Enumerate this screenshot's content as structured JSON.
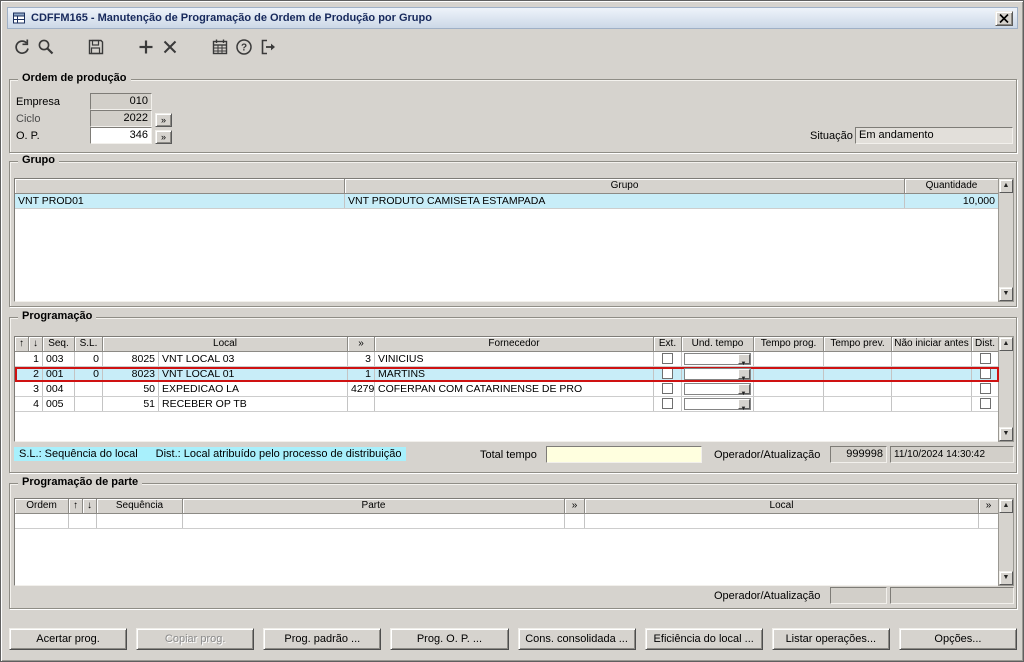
{
  "window": {
    "title": "CDFFM165 - Manutenção de Programação de Ordem de Produção por Grupo"
  },
  "colors": {
    "row_highlight": "#c8edf8",
    "selection_border": "#cf1212",
    "note_bg": "#a8f0fc",
    "total_field_bg": "#ffffdf",
    "title_text": "#17295c"
  },
  "toolbar": {
    "icons": [
      "undo",
      "search",
      "save",
      "add",
      "delete",
      "schedule",
      "help",
      "exit"
    ]
  },
  "ui": {
    "zoom": "»",
    "up": "↑",
    "down": "↓"
  },
  "ordem": {
    "legend": "Ordem de produção",
    "empresa_label": "Empresa",
    "empresa_value": "010",
    "ciclo_label": "Ciclo",
    "ciclo_value": "2022",
    "op_label": "O. P.",
    "op_value": "346",
    "situacao_label": "Situação",
    "situacao_value": "Em andamento"
  },
  "grupo": {
    "legend": "Grupo",
    "headers": {
      "grupo": "Grupo",
      "quantidade": "Quantidade"
    },
    "row": {
      "codigo": "VNT PROD01",
      "descricao": "VNT PRODUTO CAMISETA ESTAMPADA",
      "quantidade": "10,000"
    }
  },
  "prog": {
    "legend": "Programação",
    "headers": {
      "seq": "Seq.",
      "sl": "S.L.",
      "local": "Local",
      "fornecedor": "Fornecedor",
      "ext": "Ext.",
      "und_tempo": "Und. tempo",
      "tempo_prog": "Tempo prog.",
      "tempo_prev": "Tempo prev.",
      "nao_iniciar": "Não iniciar antes",
      "dist": "Dist."
    },
    "rows": [
      {
        "num": "1",
        "seq": "003",
        "sl": "0",
        "local_cod": "8025",
        "local": "VNT LOCAL 03",
        "forn_cod": "3",
        "fornecedor": "VINICIUS"
      },
      {
        "num": "2",
        "seq": "001",
        "sl": "0",
        "local_cod": "8023",
        "local": "VNT LOCAL 01",
        "forn_cod": "1",
        "fornecedor": "MARTINS"
      },
      {
        "num": "3",
        "seq": "004",
        "sl": "",
        "local_cod": "50",
        "local": "EXPEDICAO LA",
        "forn_cod": "4279",
        "fornecedor": "COFERPAN COM CATARINENSE DE PRO"
      },
      {
        "num": "4",
        "seq": "005",
        "sl": "",
        "local_cod": "51",
        "local": "RECEBER OP TB",
        "forn_cod": "",
        "fornecedor": ""
      }
    ],
    "note_sl": "S.L.: Sequência do local",
    "note_dist": "Dist.: Local atribuído pelo processo de distribuição",
    "total_tempo_label": "Total tempo",
    "operador_label": "Operador/Atualização",
    "operador_value": "999998",
    "atualizacao_value": "11/10/2024 14:30:42"
  },
  "parte": {
    "legend": "Programação de parte",
    "headers": {
      "ordem": "Ordem",
      "sequencia": "Sequência",
      "parte": "Parte",
      "local": "Local"
    },
    "operador_label": "Operador/Atualização"
  },
  "actions": {
    "buttons": [
      {
        "label": "Acertar prog.",
        "enabled": true
      },
      {
        "label": "Copiar prog.",
        "enabled": false
      },
      {
        "label": "Prog. padrão ...",
        "enabled": true
      },
      {
        "label": "Prog. O. P. ...",
        "enabled": true
      },
      {
        "label": "Cons. consolidada ...",
        "enabled": true
      },
      {
        "label": "Eficiência do local ...",
        "enabled": true
      },
      {
        "label": "Listar operações...",
        "enabled": true
      },
      {
        "label": "Opções...",
        "enabled": true
      }
    ]
  }
}
